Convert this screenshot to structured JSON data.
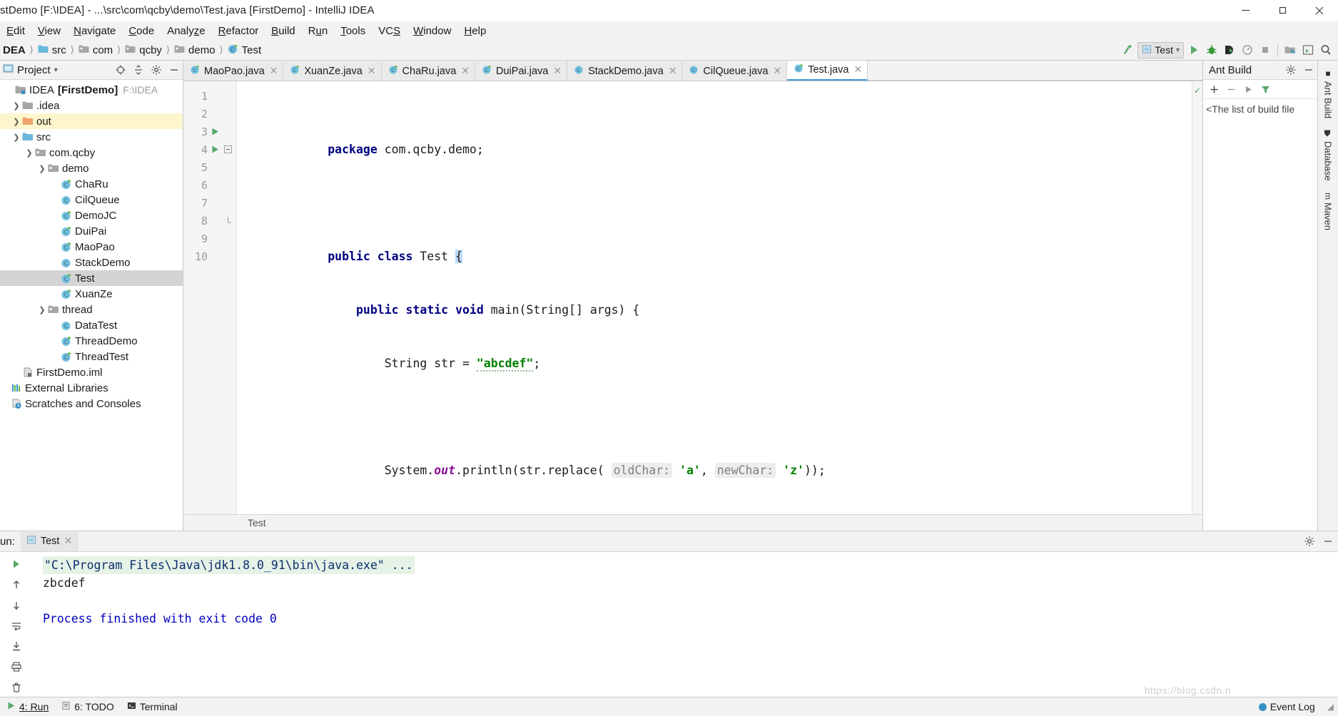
{
  "window": {
    "title": "stDemo [F:\\IDEA] - ...\\src\\com\\qcby\\demo\\Test.java [FirstDemo] - IntelliJ IDEA",
    "minimize_label": "Minimize",
    "maximize_label": "Restore",
    "close_label": "Close"
  },
  "menubar": {
    "items": [
      {
        "label": "Edit",
        "mnemonic": "E"
      },
      {
        "label": "View",
        "mnemonic": "V"
      },
      {
        "label": "Navigate",
        "mnemonic": "N"
      },
      {
        "label": "Code",
        "mnemonic": "C"
      },
      {
        "label": "Analyze",
        "mnemonic": "z"
      },
      {
        "label": "Refactor",
        "mnemonic": "R"
      },
      {
        "label": "Build",
        "mnemonic": "B"
      },
      {
        "label": "Run",
        "mnemonic": "u"
      },
      {
        "label": "Tools",
        "mnemonic": "T"
      },
      {
        "label": "VCS",
        "mnemonic": "S"
      },
      {
        "label": "Window",
        "mnemonic": "W"
      },
      {
        "label": "Help",
        "mnemonic": "H"
      }
    ]
  },
  "navbar": {
    "crumbs": [
      {
        "label": "DEA",
        "icon": "project-icon"
      },
      {
        "label": "src",
        "icon": "folder-blue-icon"
      },
      {
        "label": "com",
        "icon": "package-icon"
      },
      {
        "label": "qcby",
        "icon": "package-icon"
      },
      {
        "label": "demo",
        "icon": "package-icon"
      },
      {
        "label": "Test",
        "icon": "class-icon"
      }
    ],
    "separator": "›"
  },
  "toolbar": {
    "run_config": "Test",
    "buttons": [
      {
        "name": "build-icon",
        "label": "Build Project"
      },
      {
        "name": "run-icon",
        "label": "Run"
      },
      {
        "name": "debug-icon",
        "label": "Debug"
      },
      {
        "name": "run-coverage-icon",
        "label": "Run with Coverage"
      },
      {
        "name": "profile-icon",
        "label": "Profile"
      },
      {
        "name": "stop-icon",
        "label": "Stop"
      },
      {
        "name": "project-structure-icon",
        "label": "Project Structure"
      },
      {
        "name": "settings-icon",
        "label": "Settings"
      },
      {
        "name": "search-icon",
        "label": "Search Everywhere"
      }
    ]
  },
  "project_panel": {
    "title": "Project",
    "actions": [
      {
        "name": "locate-icon",
        "label": "Select Opened File"
      },
      {
        "name": "collapse-all-icon",
        "label": "Collapse All"
      },
      {
        "name": "gear-icon",
        "label": "Settings"
      },
      {
        "name": "hide-icon",
        "label": "Hide"
      }
    ],
    "tree": [
      {
        "label": "IDEA",
        "bold_label": "[FirstDemo]",
        "path": "F:\\IDEA",
        "indent": 0,
        "twist": "",
        "icon": "module-icon",
        "state": "root"
      },
      {
        "label": ".idea",
        "indent": 1,
        "twist": "›",
        "icon": "folder-gray-icon",
        "state": "normal"
      },
      {
        "label": "out",
        "indent": 1,
        "twist": "›",
        "icon": "folder-orange-icon",
        "state": "highlight"
      },
      {
        "label": "src",
        "indent": 1,
        "twist": "⌄",
        "icon": "folder-blue-icon",
        "state": "normal"
      },
      {
        "label": "com.qcby",
        "indent": 2,
        "twist": "⌄",
        "icon": "package-icon",
        "state": "normal"
      },
      {
        "label": "demo",
        "indent": 3,
        "twist": "⌄",
        "icon": "package-icon",
        "state": "normal"
      },
      {
        "label": "ChaRu",
        "indent": 4,
        "twist": "",
        "icon": "class-run-icon",
        "state": "normal"
      },
      {
        "label": "CilQueue",
        "indent": 4,
        "twist": "",
        "icon": "class-icon",
        "state": "normal"
      },
      {
        "label": "DemoJC",
        "indent": 4,
        "twist": "",
        "icon": "class-run-icon",
        "state": "normal"
      },
      {
        "label": "DuiPai",
        "indent": 4,
        "twist": "",
        "icon": "class-run-icon",
        "state": "normal"
      },
      {
        "label": "MaoPao",
        "indent": 4,
        "twist": "",
        "icon": "class-run-icon",
        "state": "normal"
      },
      {
        "label": "StackDemo",
        "indent": 4,
        "twist": "",
        "icon": "class-icon",
        "state": "normal"
      },
      {
        "label": "Test",
        "indent": 4,
        "twist": "",
        "icon": "class-run-icon",
        "state": "selected"
      },
      {
        "label": "XuanZe",
        "indent": 4,
        "twist": "",
        "icon": "class-run-icon",
        "state": "normal"
      },
      {
        "label": "thread",
        "indent": 3,
        "twist": "⌄",
        "icon": "package-icon",
        "state": "normal"
      },
      {
        "label": "DataTest",
        "indent": 4,
        "twist": "",
        "icon": "class-icon",
        "state": "normal"
      },
      {
        "label": "ThreadDemo",
        "indent": 4,
        "twist": "",
        "icon": "class-run-icon",
        "state": "normal"
      },
      {
        "label": "ThreadTest",
        "indent": 4,
        "twist": "",
        "icon": "class-run-icon",
        "state": "normal"
      },
      {
        "label": "FirstDemo.iml",
        "indent": 1,
        "twist": "",
        "icon": "iml-file-icon",
        "state": "normal"
      },
      {
        "label": "External Libraries",
        "indent": 0,
        "twist": "",
        "icon": "libraries-icon",
        "state": "normal"
      },
      {
        "label": "Scratches and Consoles",
        "indent": 0,
        "twist": "",
        "icon": "scratches-icon",
        "state": "normal"
      }
    ]
  },
  "editor": {
    "tabs": [
      {
        "label": "MaoPao.java",
        "active": false
      },
      {
        "label": "XuanZe.java",
        "active": false
      },
      {
        "label": "ChaRu.java",
        "active": false
      },
      {
        "label": "DuiPai.java",
        "active": false
      },
      {
        "label": "StackDemo.java",
        "active": false
      },
      {
        "label": "CilQueue.java",
        "active": false
      },
      {
        "label": "Test.java",
        "active": true
      }
    ],
    "line_numbers": [
      "1",
      "2",
      "3",
      "4",
      "5",
      "6",
      "7",
      "8",
      "9",
      "10"
    ],
    "breadcrumb": "Test",
    "code": {
      "l1_kw": "package",
      "l1_rest": " com.qcby.demo;",
      "l3_kw1": "public",
      "l3_kw2": "class",
      "l3_name": " Test ",
      "l3_brace": "{",
      "l4_kw1": "public",
      "l4_kw2": "static",
      "l4_kw3": "void",
      "l4_rest": " main(String[] args) {",
      "l5_pre": "String str = ",
      "l5_str": "\"abcdef\"",
      "l5_post": ";",
      "l7_pre": "System.",
      "l7_field": "out",
      "l7_mid": ".println(str.replace( ",
      "l7_hint1": "oldChar:",
      "l7_char1": "'a'",
      "l7_comma": ", ",
      "l7_hint2": "newChar:",
      "l7_char2": "'z'",
      "l7_post": "));",
      "l8": "}",
      "l9": "}"
    }
  },
  "ant_panel": {
    "title": "Ant Build",
    "empty_message": "<The list of build file",
    "actions": [
      {
        "name": "add-icon",
        "label": "+"
      },
      {
        "name": "remove-icon",
        "label": "−"
      },
      {
        "name": "run-icon",
        "label": "▶"
      },
      {
        "name": "filter-icon",
        "label": "Filter"
      },
      {
        "name": "gear-icon",
        "label": "Settings"
      },
      {
        "name": "hide-icon",
        "label": "Hide"
      }
    ]
  },
  "right_strip": {
    "items": [
      {
        "label": "Ant Build",
        "icon": "ant-icon"
      },
      {
        "label": "Database",
        "icon": "database-icon"
      },
      {
        "label": "Maven",
        "icon": "maven-icon"
      }
    ]
  },
  "run_panel": {
    "label": "un:",
    "tab": "Test",
    "side_buttons": [
      {
        "name": "rerun-icon",
        "label": "Rerun"
      },
      {
        "name": "scroll-up-icon",
        "label": "Up"
      },
      {
        "name": "scroll-down-icon",
        "label": "Down"
      },
      {
        "name": "soft-wrap-icon",
        "label": "Soft-Wrap"
      },
      {
        "name": "scroll-end-icon",
        "label": "Scroll to End"
      },
      {
        "name": "print-icon",
        "label": "Print"
      },
      {
        "name": "clear-all-icon",
        "label": "Clear All"
      }
    ],
    "console": {
      "command": "\"C:\\Program Files\\Java\\jdk1.8.0_91\\bin\\java.exe\" ...",
      "output": "zbcdef",
      "finished": "Process finished with exit code 0"
    },
    "header_actions": [
      {
        "name": "gear-icon",
        "label": "Settings"
      },
      {
        "name": "hide-icon",
        "label": "Hide"
      }
    ]
  },
  "statusbar": {
    "run_label": "4: Run",
    "todo_label": "6: TODO",
    "terminal_label": "Terminal",
    "event_log": "Event Log",
    "watermark": "https://blog.csdn.n"
  },
  "colors": {
    "keyword": "#000080",
    "string": "#008000",
    "field": "#871094",
    "hint_bg": "#ededed",
    "accent": "#3592c4",
    "run_green": "#59a869",
    "highlight_row": "#fdf6cd",
    "selected_row": "#d4d4d4"
  }
}
